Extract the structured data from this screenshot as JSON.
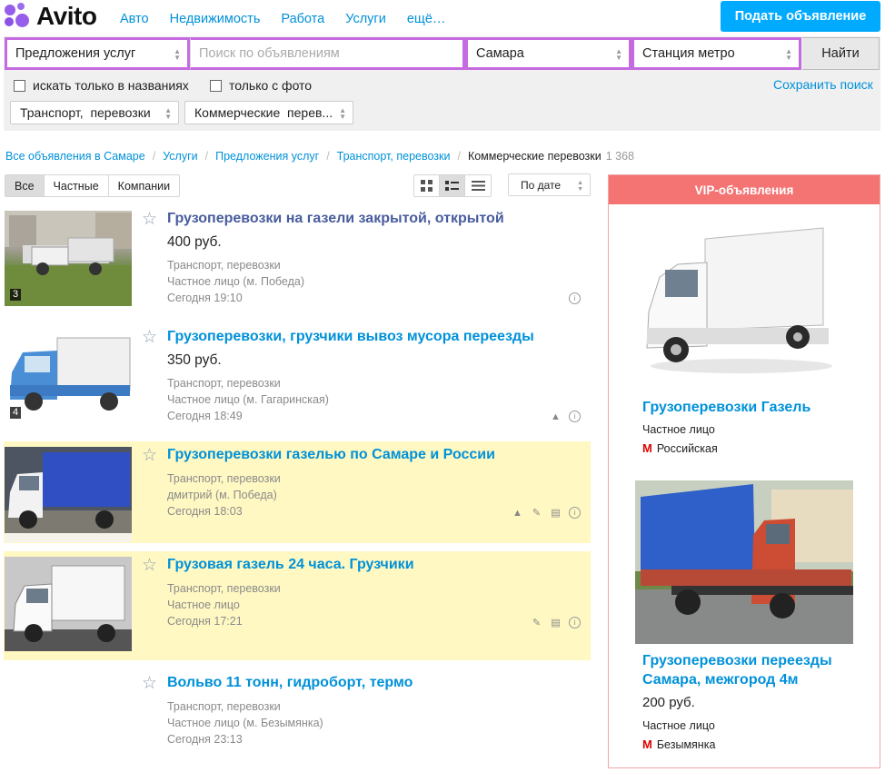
{
  "brand": {
    "logo_text": "Avito"
  },
  "topnav": [
    "Авто",
    "Недвижимость",
    "Работа",
    "Услуги",
    "ещё…"
  ],
  "post_button": "Подать объявление",
  "search": {
    "category": "Предложения услуг",
    "query_placeholder": "Поиск по объявлениям",
    "city": "Самара",
    "metro": "Станция метро",
    "find_button": "Найти",
    "only_titles": "искать только в названиях",
    "only_photo": "только с фото",
    "save_search": "Сохранить поиск",
    "sub1": "Транспорт,  перевозки",
    "sub2": "Коммерческие  перев..."
  },
  "breadcrumbs": [
    "Все объявления в Самаре",
    "Услуги",
    "Предложения услуг",
    "Транспорт, перевозки"
  ],
  "breadcrumb_current": "Коммерческие перевозки",
  "breadcrumb_count": "1 368",
  "filters": {
    "all": "Все",
    "private": "Частные",
    "companies": "Компании",
    "sort": "По дате"
  },
  "listings": [
    {
      "title": "Грузоперевозки на газели закрытой, открытой",
      "price": "400 руб.",
      "category": "Транспорт, перевозки",
      "seller": "Частное лицо (м. Победа)",
      "time": "Сегодня 19:10",
      "photos": "3"
    },
    {
      "title": "Грузоперевозки, грузчики вывоз мусора переезды",
      "price": "350 руб.",
      "category": "Транспорт, перевозки",
      "seller": "Частное лицо (м. Гагаринская)",
      "time": "Сегодня 18:49",
      "photos": "4"
    },
    {
      "title": "Грузоперевозки газелью по Самаре и России",
      "category": "Транспорт, перевозки",
      "seller": "дмитрий (м. Победа)",
      "time": "Сегодня 18:03"
    },
    {
      "title": "Грузовая газель 24 часа. Грузчики",
      "category": "Транспорт, перевозки",
      "seller": "Частное лицо",
      "time": "Сегодня 17:21"
    },
    {
      "title": "Вольво 11 тонн, гидроборт, термо",
      "category": "Транспорт, перевозки",
      "seller": "Частное лицо (м. Безымянка)",
      "time": "Сегодня 23:13"
    }
  ],
  "vip": {
    "header": "VIP-объявления",
    "items": [
      {
        "title": "Грузоперевозки Газель",
        "seller": "Частное лицо",
        "metro": "Российская"
      },
      {
        "title_line1": "Грузоперевозки переезды",
        "title_line2": "Самара, межгород 4м",
        "price": "200 руб.",
        "seller": "Частное лицо",
        "metro": "Безымянка"
      }
    ]
  },
  "colors": {
    "accent": "#0091d9",
    "post_button": "#00aaff",
    "search_border": "#c56bdf",
    "vip_header": "#f47474",
    "highlight": "#fff8c2",
    "logo_dots": "#965eeb"
  },
  "icons": [
    "star-icon",
    "info-icon",
    "up-icon",
    "paperclip-icon",
    "document-icon",
    "metro-icon",
    "grid-view-icon",
    "list-view-icon",
    "rows-view-icon"
  ]
}
